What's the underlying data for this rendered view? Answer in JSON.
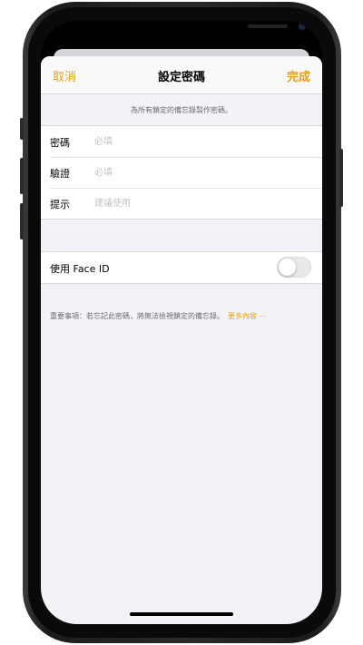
{
  "navbar": {
    "cancel_label": "取消",
    "title": "設定密碼",
    "done_label": "完成"
  },
  "header_note": "為所有鎖定的備忘錄製作密碼。",
  "fields": [
    {
      "label": "密碼",
      "placeholder": "必填"
    },
    {
      "label": "驗證",
      "placeholder": "必填"
    },
    {
      "label": "提示",
      "placeholder": "建議使用"
    }
  ],
  "face_id": {
    "label": "使用 Face ID",
    "enabled": false
  },
  "footer": {
    "note": "重要事項：若忘記此密碼，將無法檢視鎖定的備忘錄。",
    "learn_more_label": "更多內容 ⋯"
  },
  "colors": {
    "accent": "#e4a11b",
    "background": "#f2f2f7",
    "cell": "#ffffff"
  }
}
